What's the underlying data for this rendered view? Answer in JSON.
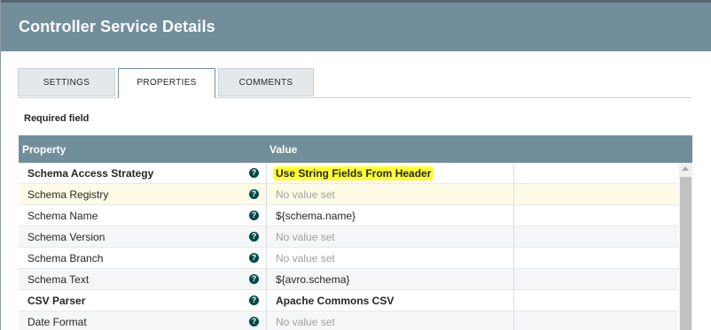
{
  "dialog": {
    "title": "Controller Service Details"
  },
  "tabs": [
    {
      "label": "SETTINGS"
    },
    {
      "label": "PROPERTIES"
    },
    {
      "label": "COMMENTS"
    }
  ],
  "required_label": "Required field",
  "table": {
    "columns": [
      "Property",
      "Value"
    ],
    "rows": [
      {
        "property": "Schema Access Strategy",
        "value": "Use String Fields From Header"
      },
      {
        "property": "Schema Registry",
        "value": "No value set"
      },
      {
        "property": "Schema Name",
        "value": "${schema.name}"
      },
      {
        "property": "Schema Version",
        "value": "No value set"
      },
      {
        "property": "Schema Branch",
        "value": "No value set"
      },
      {
        "property": "Schema Text",
        "value": "${avro.schema}"
      },
      {
        "property": "CSV Parser",
        "value": "Apache Commons CSV"
      },
      {
        "property": "Date Format",
        "value": "No value set"
      }
    ]
  },
  "icons": {
    "help": "help-icon",
    "scroll_up": "scroll-up-arrow-icon"
  },
  "colors": {
    "header": "#728e9b",
    "highlight": "#ffff33",
    "help_icon": "#004849"
  }
}
